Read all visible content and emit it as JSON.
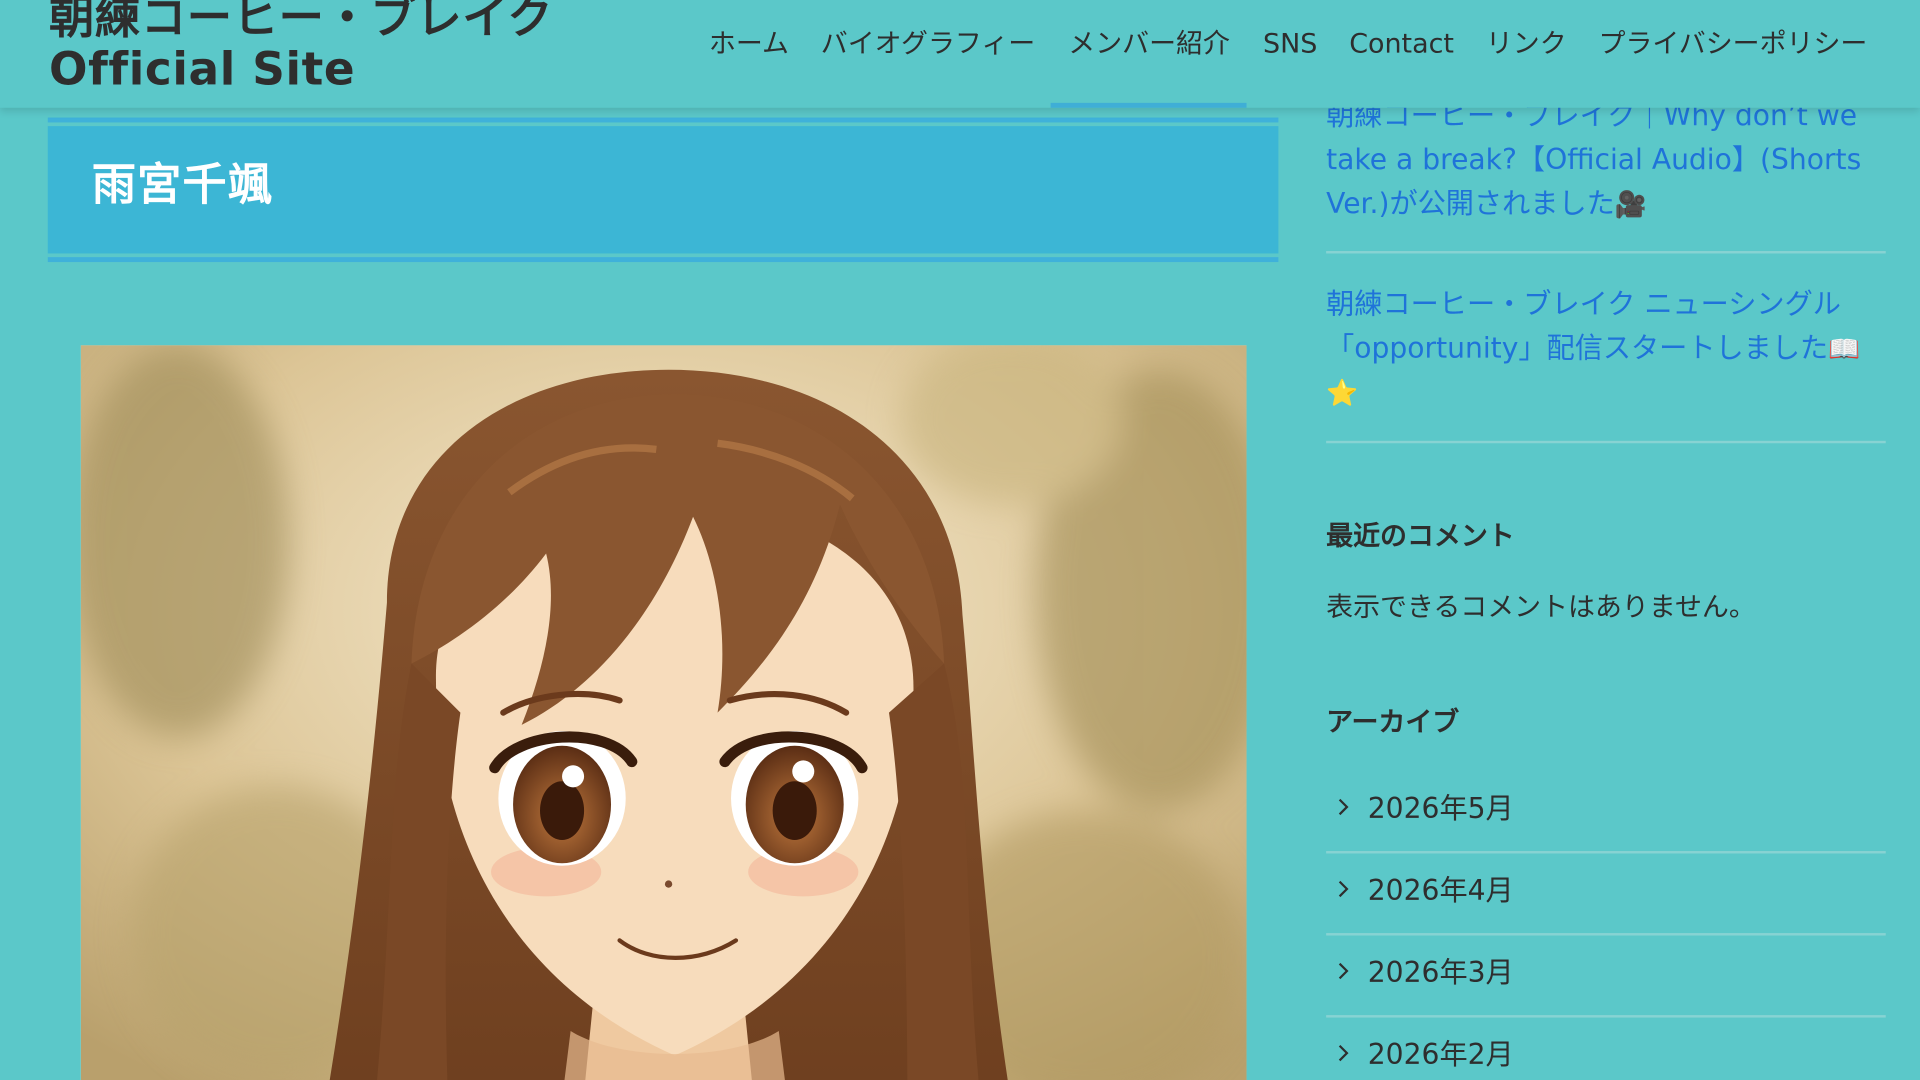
{
  "site": {
    "title_line1": "朝練コーヒー・ブレイク",
    "title_line2": "Official Site"
  },
  "nav": {
    "items": [
      {
        "label": "ホーム"
      },
      {
        "label": "バイオグラフィー"
      },
      {
        "label": "メンバー紹介",
        "active": true
      },
      {
        "label": "SNS"
      },
      {
        "label": "Contact"
      },
      {
        "label": "リンク"
      },
      {
        "label": "プライバシーポリシー"
      }
    ]
  },
  "main": {
    "page_title": "雨宮千颯",
    "image_icon": "anime-portrait-illustration"
  },
  "sidebar": {
    "recent_posts": [
      {
        "text": "朝練コーヒー・ブレイク｜Why don’t we take a break?【Official Audio】(Shorts Ver.)が公開されました",
        "emoji": "🎥"
      },
      {
        "text": "朝練コーヒー・ブレイク ニューシングル「opportunity」配信スタートしました",
        "emoji": "📖⭐"
      }
    ],
    "recent_comments": {
      "title": "最近のコメント",
      "empty_text": "表示できるコメントはありません。"
    },
    "archive": {
      "title": "アーカイブ",
      "chevron_icon": "chevron-right-icon",
      "items": [
        {
          "label": "2026年5月"
        },
        {
          "label": "2026年4月"
        },
        {
          "label": "2026年3月"
        },
        {
          "label": "2026年2月"
        }
      ]
    }
  },
  "colors": {
    "background": "#5bc8c9",
    "title_box": "#3cb6d5",
    "title_border": "#3fb1da",
    "link": "#1f73d9",
    "text": "#2e2e2e"
  }
}
